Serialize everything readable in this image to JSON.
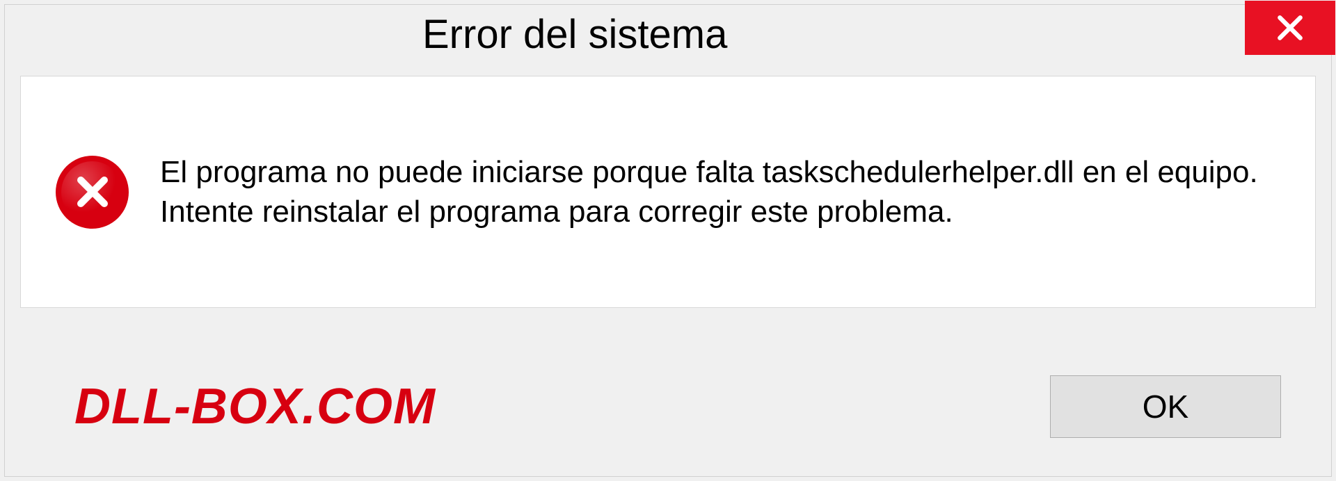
{
  "dialog": {
    "title": "Error del sistema",
    "message": "El programa no puede iniciarse porque falta taskschedulerhelper.dll en el equipo. Intente reinstalar el programa para corregir este problema.",
    "ok_label": "OK"
  },
  "branding": {
    "text": "DLL-BOX.COM"
  },
  "colors": {
    "close_red": "#e81123",
    "error_red": "#d70010",
    "brand_red": "#d70010"
  }
}
